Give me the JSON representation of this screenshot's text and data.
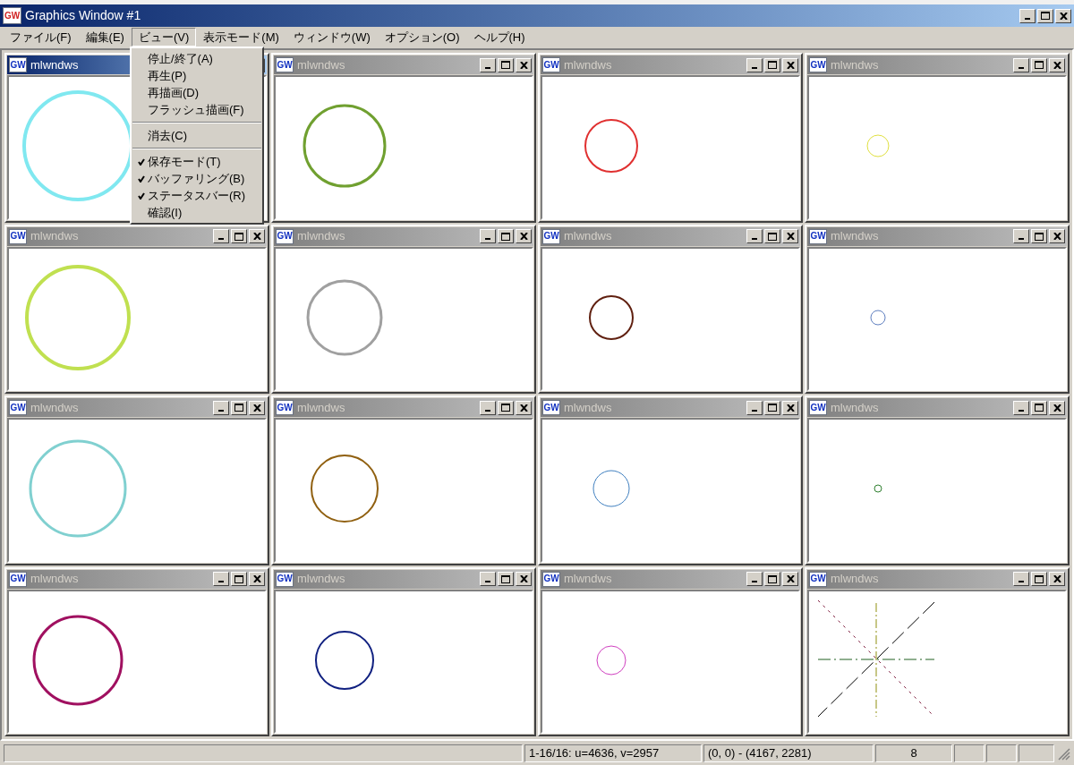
{
  "window": {
    "title": "Graphics Window #1",
    "icon_label": "GW"
  },
  "menu": [
    {
      "label": "ファイル(F)",
      "selected": false
    },
    {
      "label": "編集(E)",
      "selected": false
    },
    {
      "label": "ビュー(V)",
      "selected": true
    },
    {
      "label": "表示モード(M)",
      "selected": false
    },
    {
      "label": "ウィンドウ(W)",
      "selected": false
    },
    {
      "label": "オプション(O)",
      "selected": false
    },
    {
      "label": "ヘルプ(H)",
      "selected": false
    }
  ],
  "dropdown": [
    {
      "kind": "item",
      "label": "停止/終了(A)",
      "checked": false
    },
    {
      "kind": "item",
      "label": "再生(P)",
      "checked": false
    },
    {
      "kind": "item",
      "label": "再描画(D)",
      "checked": false
    },
    {
      "kind": "item",
      "label": "フラッシュ描画(F)",
      "checked": false
    },
    {
      "kind": "separator"
    },
    {
      "kind": "item",
      "label": "消去(C)",
      "checked": false
    },
    {
      "kind": "separator"
    },
    {
      "kind": "item",
      "label": "保存モード(T)",
      "checked": true
    },
    {
      "kind": "item",
      "label": "バッファリング(B)",
      "checked": true
    },
    {
      "kind": "item",
      "label": "ステータスバー(R)",
      "checked": true
    },
    {
      "kind": "item",
      "label": "確認(I)",
      "checked": false
    }
  ],
  "subwindows": [
    {
      "title": "mlwndws",
      "icon_label": "GW",
      "selected": true,
      "kind": "circle",
      "color": "#80e8f0"
    },
    {
      "title": "mlwndws",
      "icon_label": "GW",
      "selected": false,
      "kind": "circle",
      "color": "#70a030"
    },
    {
      "title": "mlwndws",
      "icon_label": "GW",
      "selected": false,
      "kind": "circle",
      "color": "#e03030"
    },
    {
      "title": "mlwndws",
      "icon_label": "GW",
      "selected": false,
      "kind": "circle",
      "color": "#e0e040"
    },
    {
      "title": "mlwndws",
      "icon_label": "GW",
      "selected": false,
      "kind": "circle",
      "color": "#c0e050"
    },
    {
      "title": "mlwndws",
      "icon_label": "GW",
      "selected": false,
      "kind": "circle",
      "color": "#a0a0a0"
    },
    {
      "title": "mlwndws",
      "icon_label": "GW",
      "selected": false,
      "kind": "circle",
      "color": "#602010"
    },
    {
      "title": "mlwndws",
      "icon_label": "GW",
      "selected": false,
      "kind": "circle",
      "color": "#6080c0"
    },
    {
      "title": "mlwndws",
      "icon_label": "GW",
      "selected": false,
      "kind": "circle",
      "color": "#80d0d0"
    },
    {
      "title": "mlwndws",
      "icon_label": "GW",
      "selected": false,
      "kind": "circle",
      "color": "#906010"
    },
    {
      "title": "mlwndws",
      "icon_label": "GW",
      "selected": false,
      "kind": "circle",
      "color": "#4080c0"
    },
    {
      "title": "mlwndws",
      "icon_label": "GW",
      "selected": false,
      "kind": "circle",
      "color": "#308030"
    },
    {
      "title": "mlwndws",
      "icon_label": "GW",
      "selected": false,
      "kind": "circle",
      "color": "#a01060"
    },
    {
      "title": "mlwndws",
      "icon_label": "GW",
      "selected": false,
      "kind": "circle",
      "color": "#102080"
    },
    {
      "title": "mlwndws",
      "icon_label": "GW",
      "selected": false,
      "kind": "circle",
      "color": "#d040c0"
    },
    {
      "title": "mlwndws",
      "icon_label": "GW",
      "selected": false,
      "kind": "crosshair"
    }
  ],
  "status_bar": [
    "1-16/16: u=4636, v=2957",
    "(0, 0) - (4167, 2281)",
    "8"
  ]
}
